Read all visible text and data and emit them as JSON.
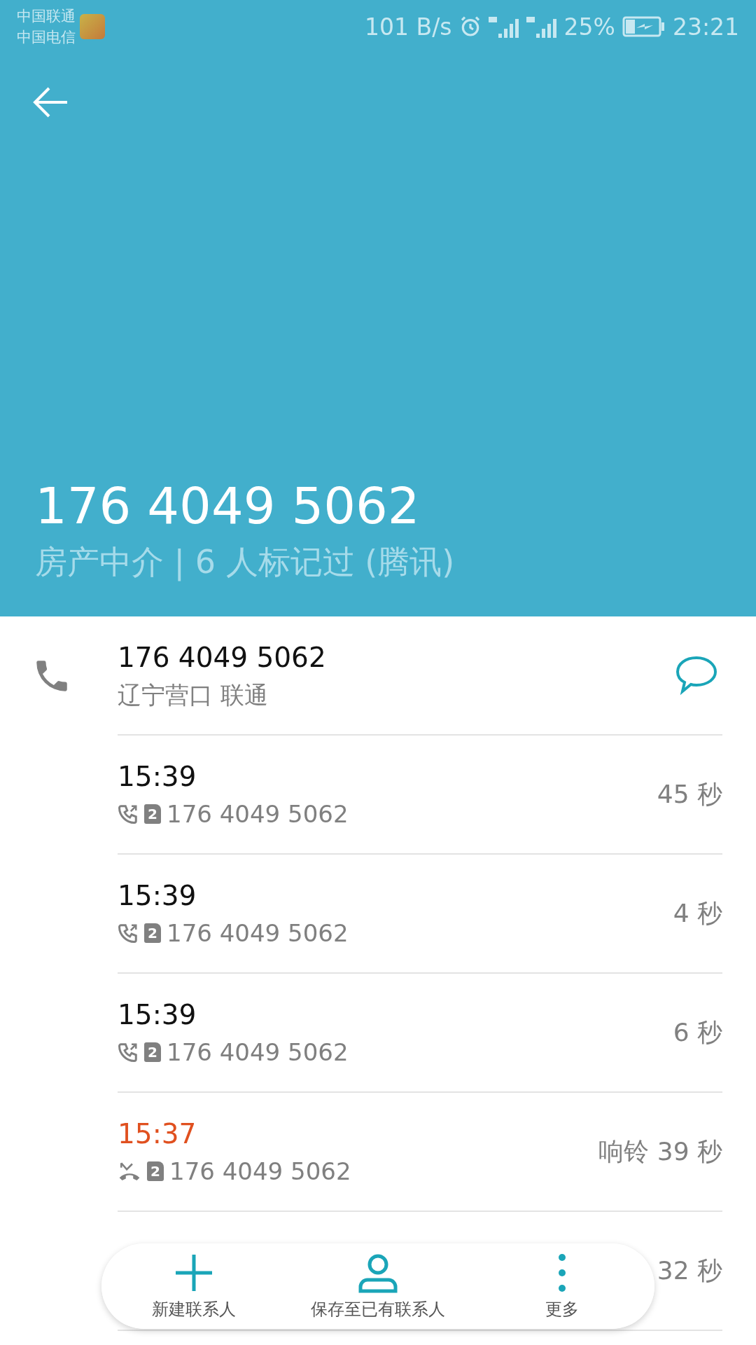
{
  "status_bar": {
    "carriers": [
      "中国联通",
      "中国电信"
    ],
    "speed": "101 B/s",
    "battery": "25%",
    "time": "23:21"
  },
  "header": {
    "number": "176 4049 5062",
    "tag": "房产中介 | 6 人标记过 (腾讯)"
  },
  "contact": {
    "number": "176 4049 5062",
    "location": "辽宁营口 联通"
  },
  "calls": [
    {
      "time": "15:39",
      "kind": "outgoing",
      "missed": false,
      "sim": "2",
      "number": "176 4049 5062",
      "duration": "45 秒"
    },
    {
      "time": "15:39",
      "kind": "outgoing",
      "missed": false,
      "sim": "2",
      "number": "176 4049 5062",
      "duration": "4 秒"
    },
    {
      "time": "15:39",
      "kind": "outgoing",
      "missed": false,
      "sim": "2",
      "number": "176 4049 5062",
      "duration": "6 秒"
    },
    {
      "time": "15:37",
      "kind": "missed",
      "missed": true,
      "sim": "2",
      "number": "176 4049 5062",
      "duration": "响铃 39 秒"
    },
    {
      "duration": "32 秒"
    }
  ],
  "actions": [
    {
      "kind": "add",
      "label": "新建联系人"
    },
    {
      "kind": "person",
      "label": "保存至已有联系人"
    },
    {
      "kind": "more",
      "label": "更多"
    }
  ]
}
